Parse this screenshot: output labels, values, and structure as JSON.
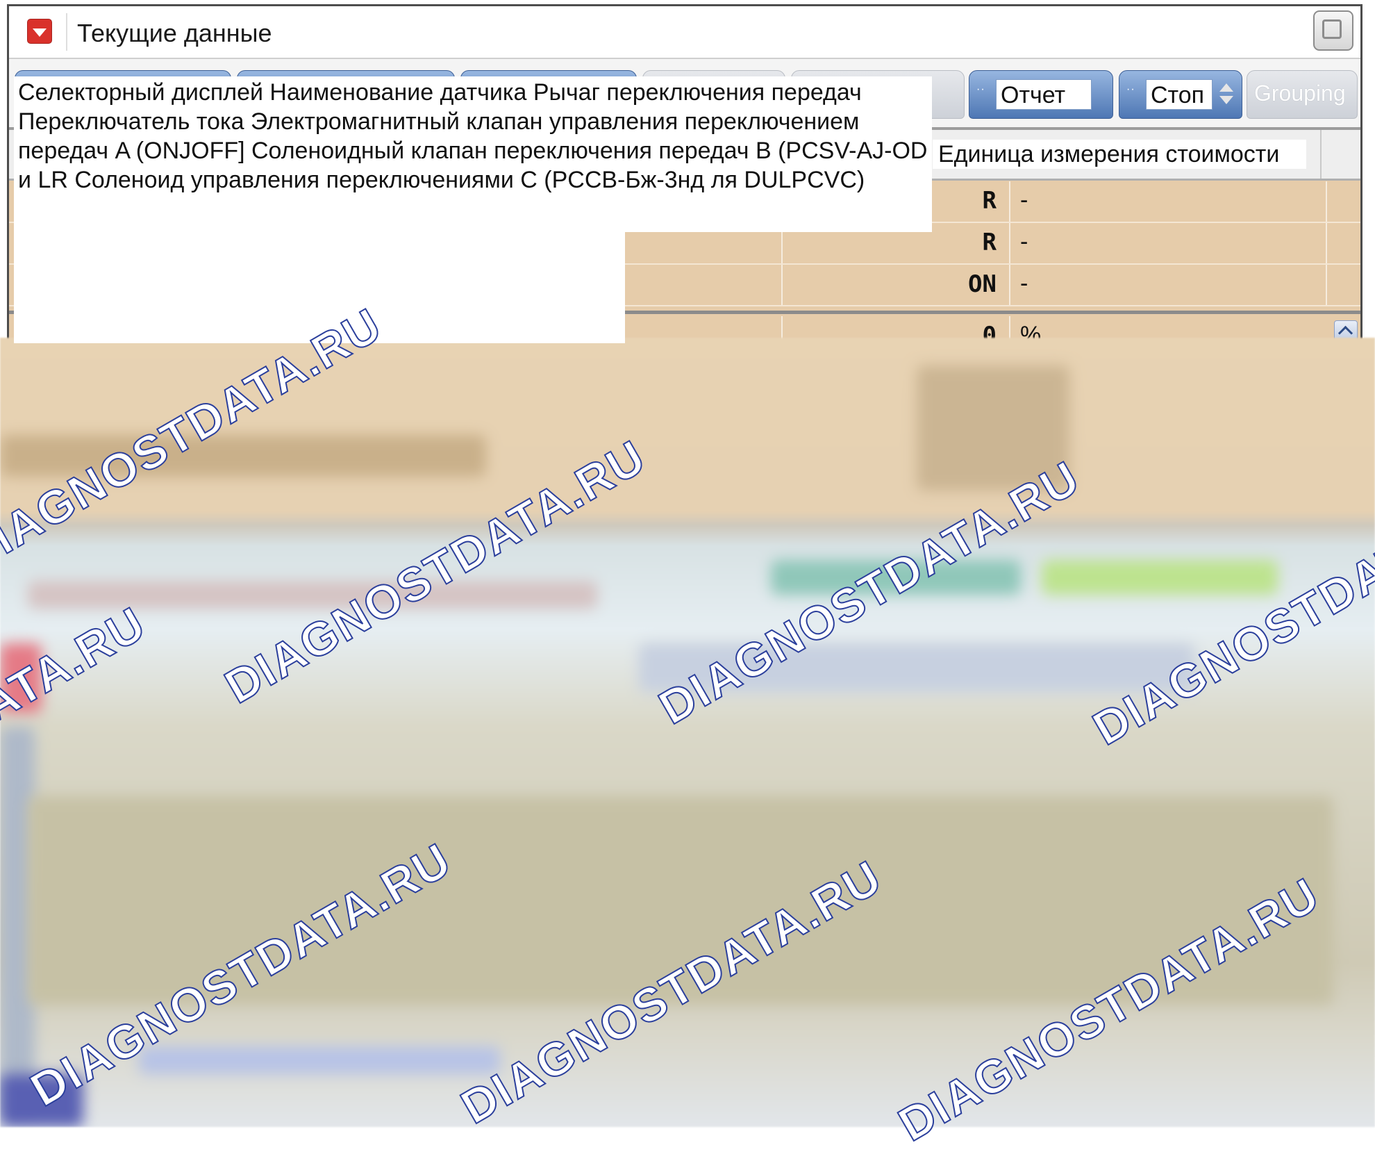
{
  "window": {
    "title": "Текущие данные"
  },
  "toolbar": {
    "report_label": "Отчет",
    "stop_label": "Стоп",
    "grouping_label": "Grouping"
  },
  "tooltip": {
    "text": "Селекторный дисплей Наименование датчика Рычаг переключения передач Переключатель тока Электромагнитный клапан управления переключением передач A (ONJOFF] Соленоидный клапан переключения передач B (PCSV-AJ-OD и LR Соленоид управления переключениями C (PCCB-Бж-3нд ля DULPCVC)"
  },
  "grid": {
    "header_unit": "Единица измерения стоимости",
    "rows": [
      {
        "value": "R",
        "unit": "-"
      },
      {
        "value": "R",
        "unit": "-"
      },
      {
        "value": "ON",
        "unit": "-"
      },
      {
        "value": "0",
        "unit": "%"
      }
    ]
  },
  "watermark": {
    "text": "DIAGNOSTDATA.RU"
  },
  "colors": {
    "grid_bg": "#e6ccaa",
    "toolbar_btn": "#5a83bf",
    "watermark_stroke": "#2b3f9c"
  }
}
